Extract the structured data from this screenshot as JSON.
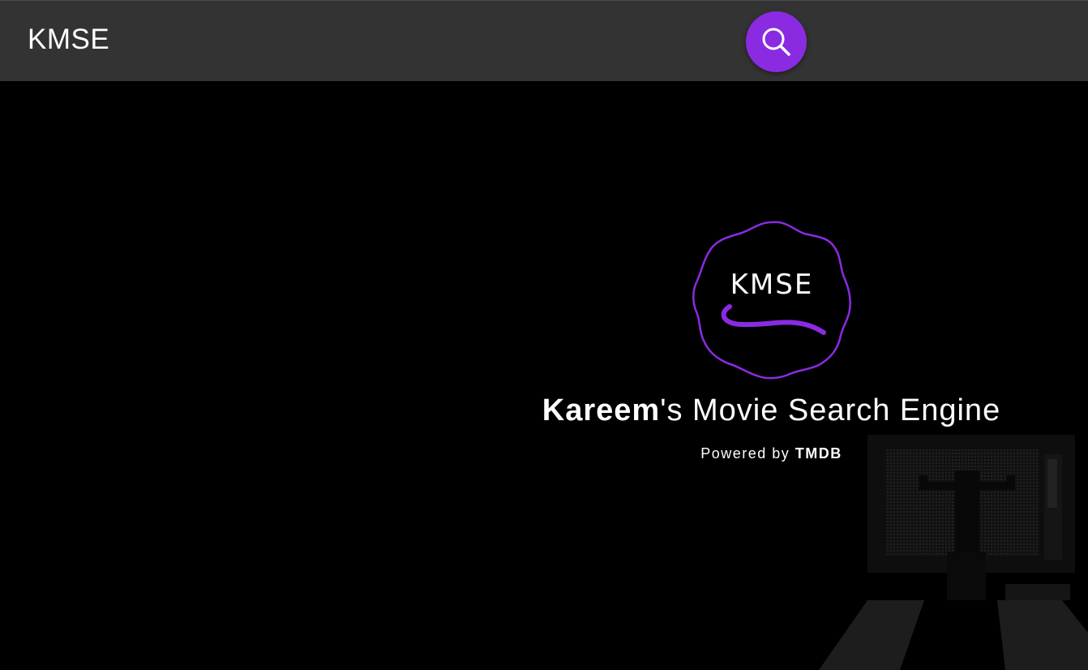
{
  "header": {
    "brand": "KMSE",
    "search_icon": "search-icon"
  },
  "hero": {
    "logo_text": "KMSE",
    "title_name": "Kareem",
    "title_rest": "'s Movie Search Engine",
    "powered_prefix": "Powered by ",
    "powered_source": "TMDB",
    "background_art": "tv-figure-art"
  },
  "colors": {
    "topbar_bg": "#333333",
    "accent": "#8a2be2",
    "page_bg": "#000000",
    "text": "#ffffff"
  }
}
